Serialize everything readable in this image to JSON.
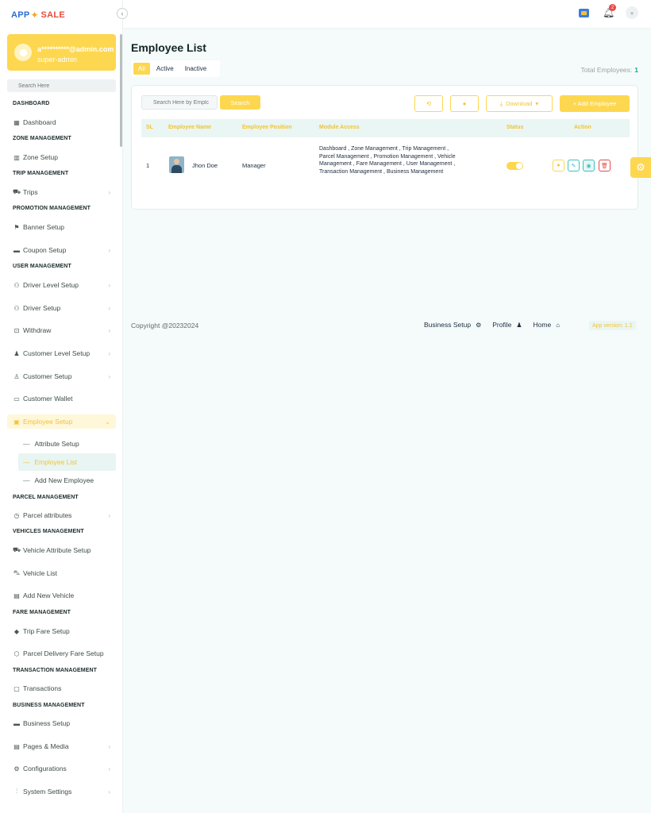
{
  "brand": {
    "logo_part1": "APP",
    "logo_part2": "SALE"
  },
  "topbar": {
    "notification_count": "2"
  },
  "user": {
    "email": "a**********@admin.com",
    "role": "super-admin"
  },
  "sidebar": {
    "search_placeholder": "Search Here",
    "sections": {
      "dashboard": "DASHBOARD",
      "zone": "ZONE MANAGEMENT",
      "trip": "TRIP MANAGEMENT",
      "promotion": "PROMOTION MANAGEMENT",
      "user": "USER MANAGEMENT",
      "parcel": "PARCEL MANAGEMENT",
      "vehicles": "VEHICLES MANAGEMENT",
      "fare": "FARE MANAGEMENT",
      "transaction": "TRANSACTION MANAGEMENT",
      "business": "BUSINESS MANAGEMENT"
    },
    "items": {
      "dashboard": "Dashboard",
      "zone_setup": "Zone Setup",
      "trips": "Trips",
      "banner_setup": "Banner Setup",
      "coupon_setup": "Coupon Setup",
      "driver_level_setup": "Driver Level Setup",
      "driver_setup": "Driver Setup",
      "withdraw": "Withdraw",
      "customer_level_setup": "Customer Level Setup",
      "customer_setup": "Customer Setup",
      "customer_wallet": "Customer Wallet",
      "employee_setup": "Employee Setup",
      "attribute_setup": "Attribute Setup",
      "employee_list": "Employee List",
      "add_new_employee": "Add New Employee",
      "parcel_attributes": "Parcel attributes",
      "vehicle_attribute_setup": "Vehicle Attribute Setup",
      "vehicle_list": "Vehicle List",
      "add_new_vehicle": "Add New Vehicle",
      "trip_fare_setup": "Trip Fare Setup",
      "parcel_delivery_fare_setup": "Parcel Delivery Fare Setup",
      "transactions": "Transactions",
      "business_setup": "Business Setup",
      "pages_media": "Pages & Media",
      "configurations": "Configurations",
      "system_settings": "System Settings"
    }
  },
  "main": {
    "title": "Employee List",
    "tabs": {
      "all": "All",
      "active": "Active",
      "inactive": "Inactive"
    },
    "total_label": "Total Employees:",
    "total_value": "1",
    "search_placeholder": "Search Here by Emplc",
    "search_button": "Search",
    "download_label": "Download",
    "add_employee_label": "+ Add Employee",
    "table": {
      "columns": {
        "sl": "SL",
        "name": "Employee Name",
        "position": "Employee Position",
        "module": "Module Access",
        "status": "Status",
        "action": "Action"
      },
      "rows": [
        {
          "sl": "1",
          "name": "Jhon Doe",
          "position": "Manager",
          "module": "Dashboard , Zone Management , Trip Management , Parcel Management , Promotion Management , Vehicle Management , Fare Management , User Management , Transaction Management , Business Management",
          "status_on": true
        }
      ]
    }
  },
  "footer": {
    "copyright": "Copyright @20232024",
    "business_setup": "Business Setup",
    "profile": "Profile",
    "home": "Home",
    "app_version": "App version: 1.1"
  },
  "colors": {
    "accent": "#fdd74f",
    "accent_text": "#f3c331",
    "teal": "#39c2c0",
    "danger": "#e64a4a"
  }
}
